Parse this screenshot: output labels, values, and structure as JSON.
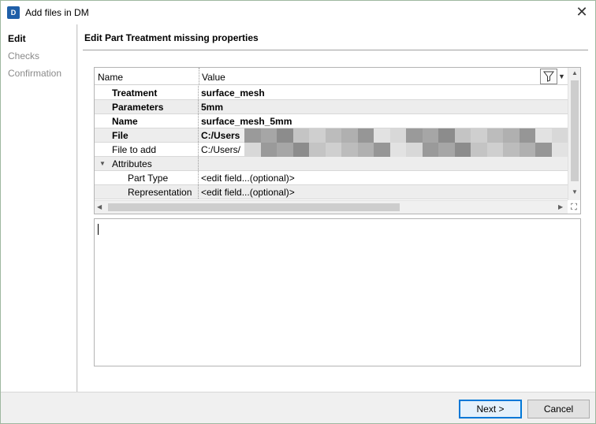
{
  "window": {
    "title": "Add files in DM",
    "icon": "app-logo-icon",
    "icon_letter": "D",
    "close_glyph": "✕"
  },
  "nav": {
    "items": [
      {
        "label": "Edit",
        "active": true
      },
      {
        "label": "Checks",
        "active": false
      },
      {
        "label": "Confirmation",
        "active": false
      }
    ]
  },
  "main": {
    "title": "Edit Part Treatment missing properties"
  },
  "grid": {
    "columns": [
      "Name",
      "Value"
    ],
    "rows": [
      {
        "name": "Treatment",
        "value": "surface_mesh",
        "bold": true
      },
      {
        "name": "Parameters",
        "value": "5mm",
        "bold": true
      },
      {
        "name": "Name",
        "value": "surface_mesh_5mm",
        "bold": true
      },
      {
        "name": "File",
        "value": "C:/Users",
        "bold": true
      },
      {
        "name": "File to add",
        "value": "C:/Users/",
        "bold": false
      },
      {
        "name": "Attributes",
        "value": "",
        "bold": false,
        "group": true
      },
      {
        "name": "Part Type",
        "value": "<edit field...(optional)>",
        "bold": false
      },
      {
        "name": "Representation",
        "value": "<edit field...(optional)>",
        "bold": false
      }
    ]
  },
  "buttons": {
    "next": "Next >",
    "cancel": "Cancel"
  },
  "colors": {
    "accent": "#0078d7",
    "title_icon": "#1f5fa8"
  }
}
